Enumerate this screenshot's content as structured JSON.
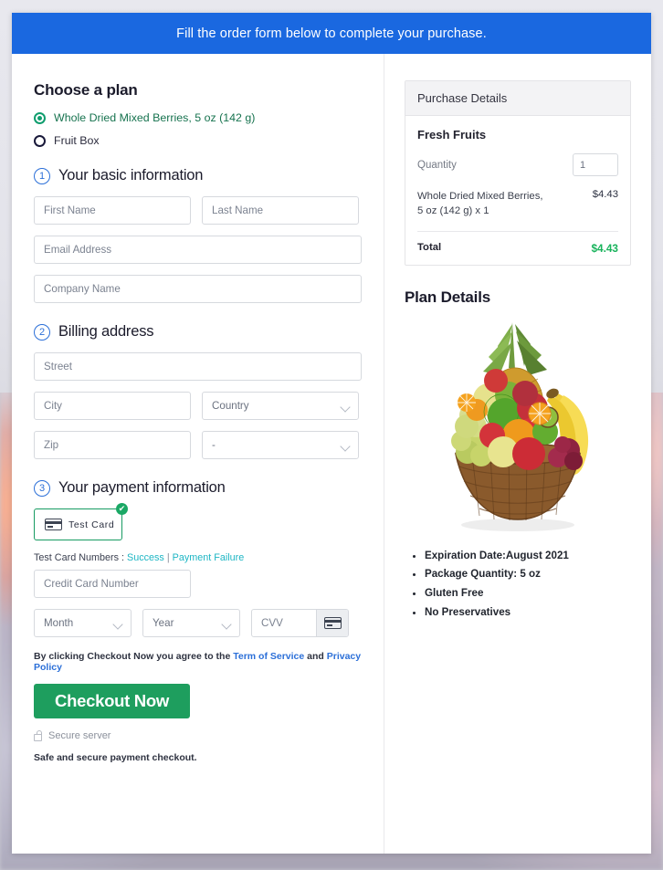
{
  "banner": {
    "text": "Fill the order form below to complete your purchase."
  },
  "plan": {
    "heading": "Choose a plan",
    "options": [
      {
        "label": "Whole Dried Mixed Berries, 5 oz (142 g)",
        "selected": true
      },
      {
        "label": "Fruit Box",
        "selected": false
      }
    ]
  },
  "steps": {
    "basic": {
      "number": "1",
      "title": "Your basic information",
      "first_name_placeholder": "First Name",
      "last_name_placeholder": "Last Name",
      "email_placeholder": "Email Address",
      "company_placeholder": "Company Name"
    },
    "billing": {
      "number": "2",
      "title": "Billing address",
      "street_placeholder": "Street",
      "city_placeholder": "City",
      "country_value": "Country",
      "zip_placeholder": "Zip",
      "state_value": "-"
    },
    "payment": {
      "number": "3",
      "title": "Your payment information",
      "card_chip_label": "Test  Card",
      "card_chip_check": "✔",
      "test_card_prefix": "Test Card Numbers :",
      "link_success": "Success",
      "link_separator": "|",
      "link_failure": "Payment Failure",
      "credit_card_placeholder": "Credit Card Number",
      "month_value": "Month",
      "year_value": "Year",
      "cvv_placeholder": "CVV",
      "terms_pre": "By clicking Checkout Now you agree to the ",
      "terms_link_1": "Term of Service",
      "terms_mid": " and ",
      "terms_link_2": "Privacy Policy",
      "checkout_label": "Checkout Now",
      "secure_server": "Secure server",
      "safe_note": "Safe and secure payment checkout."
    }
  },
  "purchase": {
    "header": "Purchase Details",
    "product_name": "Fresh Fruits",
    "quantity_label": "Quantity",
    "quantity_value": "1",
    "item_name": "Whole Dried Mixed Berries, 5 oz (142 g) x 1",
    "item_price": "$4.43",
    "total_label": "Total",
    "total_value": "$4.43"
  },
  "plan_details": {
    "heading": "Plan Details",
    "image_alt": "fruit-basket",
    "features": [
      "Expiration Date:August 2021",
      "Package Quantity: 5 oz",
      "Gluten Free",
      "No Preservatives"
    ]
  },
  "colors": {
    "banner_blue": "#1a68e0",
    "checkout_green": "#1e9e5e",
    "total_green": "#19b35c",
    "link_teal": "#1eb6c4",
    "step_blue": "#2b6fd8"
  }
}
